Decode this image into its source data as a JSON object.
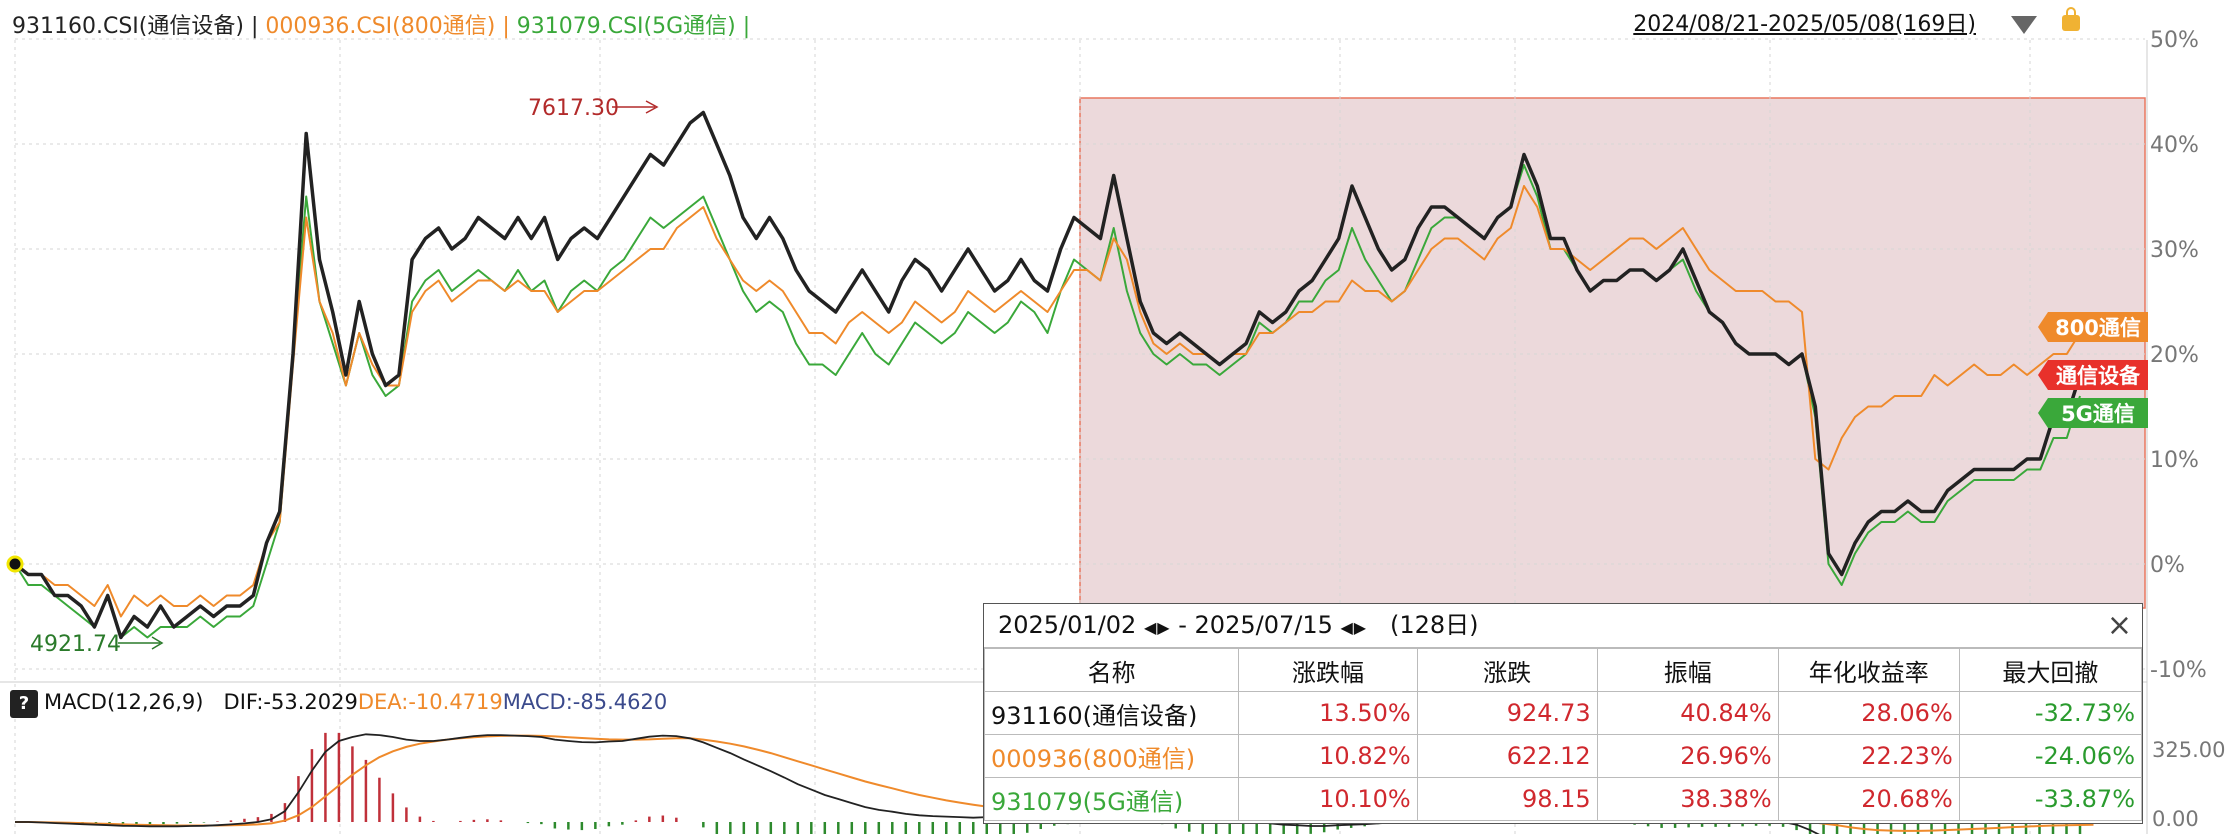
{
  "header": {
    "legend": [
      {
        "text": "931160.CSI(通信设备)",
        "color": "#222222"
      },
      {
        "text": " | ",
        "color": "#222222"
      },
      {
        "text": "000936.CSI(800通信)",
        "color": "#ef8a2b"
      },
      {
        "text": " | ",
        "color": "#ef8a2b"
      },
      {
        "text": "931079.CSI(5G通信)",
        "color": "#3aa83a"
      },
      {
        "text": " |",
        "color": "#3aa83a"
      }
    ],
    "date_range": "2024/08/21-2025/05/08(169日)",
    "dropdown_icon": "caret-down-icon",
    "lock_icon": "lock-icon"
  },
  "chart_data": {
    "type": "line",
    "yaxis_ticks": [
      "50%",
      "40%",
      "30%",
      "20%",
      "10%",
      "0%",
      "-10%"
    ],
    "ylim": [
      -10,
      50
    ],
    "annotations": {
      "high": "7617.30",
      "low": "4921.74"
    },
    "series": [
      {
        "name": "通信设备",
        "color": "#222222",
        "values": [
          0,
          -1,
          -1,
          -3,
          -3,
          -4,
          -6,
          -3,
          -7,
          -5,
          -6,
          -4,
          -6,
          -5,
          -4,
          -5,
          -4,
          -4,
          -3,
          2,
          5,
          20,
          41,
          29,
          24,
          18,
          25,
          20,
          17,
          18,
          29,
          31,
          32,
          30,
          31,
          33,
          32,
          31,
          33,
          31,
          33,
          29,
          31,
          32,
          31,
          33,
          35,
          37,
          39,
          38,
          40,
          42,
          43,
          40,
          37,
          33,
          31,
          33,
          31,
          28,
          26,
          25,
          24,
          26,
          28,
          26,
          24,
          27,
          29,
          28,
          26,
          28,
          30,
          28,
          26,
          27,
          29,
          27,
          26,
          30,
          33,
          32,
          31,
          37,
          31,
          25,
          22,
          21,
          22,
          21,
          20,
          19,
          20,
          21,
          24,
          23,
          24,
          26,
          27,
          29,
          31,
          36,
          33,
          30,
          28,
          29,
          32,
          34,
          34,
          33,
          32,
          31,
          33,
          34,
          39,
          36,
          31,
          31,
          28,
          26,
          27,
          27,
          28,
          28,
          27,
          28,
          30,
          27,
          24,
          23,
          21,
          20,
          20,
          20,
          19,
          20,
          15,
          1,
          -1,
          2,
          4,
          5,
          5,
          6,
          5,
          5,
          7,
          8,
          9,
          9,
          9,
          9,
          10,
          10,
          14,
          14,
          18
        ]
      },
      {
        "name": "800通信",
        "color": "#ef8a2b",
        "values": [
          0,
          -1,
          -1,
          -2,
          -2,
          -3,
          -4,
          -2,
          -5,
          -3,
          -4,
          -3,
          -4,
          -4,
          -3,
          -4,
          -3,
          -3,
          -2,
          2,
          4,
          19,
          33,
          25,
          22,
          17,
          22,
          19,
          17,
          17,
          24,
          26,
          27,
          25,
          26,
          27,
          27,
          26,
          27,
          26,
          26,
          24,
          25,
          26,
          26,
          27,
          28,
          29,
          30,
          30,
          32,
          33,
          34,
          31,
          29,
          27,
          26,
          27,
          26,
          24,
          22,
          22,
          21,
          23,
          24,
          23,
          22,
          23,
          25,
          24,
          23,
          24,
          26,
          25,
          24,
          25,
          26,
          25,
          24,
          26,
          28,
          28,
          27,
          31,
          29,
          24,
          21,
          20,
          21,
          20,
          20,
          19,
          20,
          20,
          22,
          22,
          23,
          24,
          24,
          25,
          25,
          27,
          26,
          26,
          25,
          26,
          28,
          30,
          31,
          31,
          30,
          29,
          31,
          32,
          36,
          34,
          30,
          30,
          29,
          28,
          29,
          30,
          31,
          31,
          30,
          31,
          32,
          30,
          28,
          27,
          26,
          26,
          26,
          25,
          25,
          24,
          10,
          9,
          12,
          14,
          15,
          15,
          16,
          16,
          16,
          18,
          17,
          18,
          19,
          18,
          18,
          19,
          18,
          19,
          20,
          20,
          22
        ]
      },
      {
        "name": "5G通信",
        "color": "#3aa83a",
        "values": [
          0,
          -2,
          -2,
          -3,
          -4,
          -5,
          -6,
          -3,
          -7,
          -6,
          -7,
          -6,
          -6,
          -6,
          -5,
          -6,
          -5,
          -5,
          -4,
          0,
          4,
          20,
          35,
          25,
          21,
          17,
          22,
          18,
          16,
          17,
          25,
          27,
          28,
          26,
          27,
          28,
          27,
          26,
          28,
          26,
          27,
          24,
          26,
          27,
          26,
          28,
          29,
          31,
          33,
          32,
          33,
          34,
          35,
          32,
          29,
          26,
          24,
          25,
          24,
          21,
          19,
          19,
          18,
          20,
          22,
          20,
          19,
          21,
          23,
          22,
          21,
          22,
          24,
          23,
          22,
          23,
          25,
          24,
          22,
          26,
          29,
          28,
          27,
          32,
          26,
          22,
          20,
          19,
          20,
          19,
          19,
          18,
          19,
          20,
          23,
          22,
          23,
          25,
          25,
          27,
          28,
          32,
          29,
          27,
          25,
          26,
          29,
          32,
          33,
          33,
          32,
          31,
          33,
          34,
          38,
          35,
          30,
          30,
          28,
          26,
          27,
          27,
          28,
          28,
          27,
          28,
          29,
          26,
          24,
          23,
          21,
          20,
          20,
          20,
          19,
          20,
          14,
          0,
          -2,
          1,
          3,
          4,
          4,
          5,
          4,
          4,
          6,
          7,
          8,
          8,
          8,
          8,
          9,
          9,
          12,
          12,
          16
        ]
      }
    ],
    "end_labels": {
      "s800": "800通信",
      "comm": "通信设备",
      "g5": "5G通信"
    },
    "macd": {
      "label": "MACD(12,26,9)",
      "dif": "DIF:-53.2029",
      "dea": "DEA:-10.4719",
      "macd": "MACD:-85.4620",
      "yaxis_ticks": [
        "325.00",
        "0.00"
      ],
      "dif_values": [
        0,
        0,
        -2,
        -4,
        -6,
        -8,
        -10,
        -12,
        -14,
        -15,
        -16,
        -16,
        -16,
        -15,
        -14,
        -12,
        -9,
        -5,
        0,
        10,
        40,
        110,
        190,
        260,
        300,
        315,
        325,
        322,
        315,
        305,
        300,
        300,
        305,
        312,
        318,
        322,
        322,
        320,
        318,
        315,
        305,
        300,
        296,
        295,
        298,
        300,
        308,
        316,
        320,
        318,
        310,
        295,
        275,
        255,
        232,
        210,
        188,
        165,
        140,
        120,
        100,
        85,
        70,
        55,
        45,
        38,
        30,
        25,
        22,
        20,
        18,
        16,
        18,
        20,
        22,
        25,
        30,
        35,
        38,
        42,
        48,
        55,
        60,
        64,
        60,
        50,
        40,
        30,
        22,
        15,
        10,
        5,
        0,
        -5,
        -10,
        -12,
        -15,
        -15,
        -12,
        -10,
        -8,
        -5,
        -2,
        0,
        5,
        10,
        15,
        20,
        25,
        30,
        35,
        40,
        45,
        50,
        52,
        53,
        52,
        50,
        45,
        40,
        35,
        30,
        25,
        22,
        20,
        18,
        15,
        12,
        10,
        8,
        5,
        0,
        -10,
        -30,
        -55,
        -70,
        -80,
        -85,
        -82,
        -78,
        -74,
        -70,
        -66,
        -63,
        -60,
        -58,
        -57,
        -56,
        -55,
        -54,
        -53,
        -53,
        -53,
        -53
      ],
      "dea_values": [
        0,
        0,
        -1,
        -2,
        -3,
        -4,
        -6,
        -7,
        -9,
        -10,
        -11,
        -12,
        -13,
        -13,
        -13,
        -13,
        -12,
        -11,
        -9,
        -5,
        5,
        25,
        55,
        95,
        135,
        175,
        210,
        240,
        262,
        278,
        290,
        298,
        305,
        310,
        314,
        317,
        319,
        320,
        320,
        319,
        317,
        314,
        311,
        308,
        306,
        305,
        305,
        306,
        308,
        310,
        310,
        305,
        298,
        290,
        280,
        268,
        255,
        240,
        225,
        210,
        195,
        180,
        165,
        150,
        137,
        125,
        112,
        100,
        90,
        80,
        72,
        64,
        57,
        52,
        48,
        45,
        43,
        42,
        42,
        42,
        44,
        46,
        49,
        52,
        55,
        54,
        52,
        48,
        44,
        39,
        34,
        29,
        24,
        19,
        15,
        11,
        7,
        4,
        2,
        1,
        0,
        -1,
        -1,
        -1,
        0,
        2,
        4,
        7,
        10,
        13,
        17,
        21,
        25,
        29,
        32,
        35,
        38,
        40,
        41,
        41,
        40,
        38,
        36,
        33,
        30,
        27,
        24,
        21,
        18,
        15,
        12,
        9,
        5,
        0,
        -6,
        -12,
        -20,
        -26,
        -30,
        -32,
        -33,
        -33,
        -32,
        -30,
        -28,
        -26,
        -24,
        -22,
        -19,
        -17,
        -15,
        -13,
        -12,
        -11,
        -10
      ]
    }
  },
  "popup": {
    "start_date": "2025/01/02",
    "end_date": "2025/07/15",
    "sep": "-",
    "days": "(128日)",
    "close": "×",
    "columns": [
      "名称",
      "涨跌幅",
      "涨跌",
      "振幅",
      "年化收益率",
      "最大回撤"
    ],
    "rows": [
      {
        "name": "931160(通信设备)",
        "name_color": "#111111",
        "chg_pct": "13.50%",
        "chg": "924.73",
        "amp": "40.84%",
        "annual": "28.06%",
        "mdd": "-32.73%"
      },
      {
        "name": "000936(800通信)",
        "name_color": "#ef8a2b",
        "chg_pct": "10.82%",
        "chg": "622.12",
        "amp": "26.96%",
        "annual": "22.23%",
        "mdd": "-24.06%"
      },
      {
        "name": "931079(5G通信)",
        "name_color": "#3aa83a",
        "chg_pct": "10.10%",
        "chg": "98.15",
        "amp": "38.38%",
        "annual": "20.68%",
        "mdd": "-33.87%"
      }
    ]
  }
}
